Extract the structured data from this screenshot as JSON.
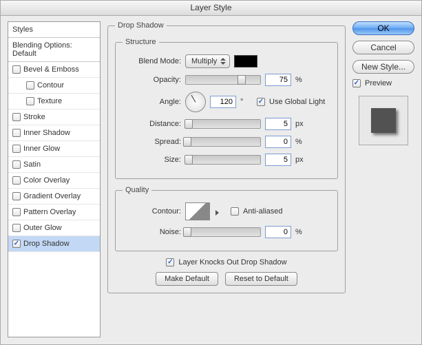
{
  "title": "Layer Style",
  "sidebar": {
    "styles_header": "Styles",
    "blending_header": "Blending Options: Default",
    "items": [
      {
        "label": "Bevel & Emboss",
        "checked": false
      },
      {
        "label": "Contour",
        "checked": false,
        "sub": true
      },
      {
        "label": "Texture",
        "checked": false,
        "sub": true
      },
      {
        "label": "Stroke",
        "checked": false
      },
      {
        "label": "Inner Shadow",
        "checked": false
      },
      {
        "label": "Inner Glow",
        "checked": false
      },
      {
        "label": "Satin",
        "checked": false
      },
      {
        "label": "Color Overlay",
        "checked": false
      },
      {
        "label": "Gradient Overlay",
        "checked": false
      },
      {
        "label": "Pattern Overlay",
        "checked": false
      },
      {
        "label": "Outer Glow",
        "checked": false
      },
      {
        "label": "Drop Shadow",
        "checked": true,
        "selected": true
      }
    ]
  },
  "panel": {
    "heading": "Drop Shadow",
    "structure": {
      "legend": "Structure",
      "blend_mode_label": "Blend Mode:",
      "blend_mode_value": "Multiply",
      "opacity_label": "Opacity:",
      "opacity_value": "75",
      "opacity_unit": "%",
      "angle_label": "Angle:",
      "angle_value": "120",
      "angle_unit": "°",
      "use_global_label": "Use Global Light",
      "use_global_checked": true,
      "distance_label": "Distance:",
      "distance_value": "5",
      "distance_unit": "px",
      "spread_label": "Spread:",
      "spread_value": "0",
      "spread_unit": "%",
      "size_label": "Size:",
      "size_value": "5",
      "size_unit": "px"
    },
    "quality": {
      "legend": "Quality",
      "contour_label": "Contour:",
      "anti_aliased_label": "Anti-aliased",
      "anti_aliased_checked": false,
      "noise_label": "Noise:",
      "noise_value": "0",
      "noise_unit": "%"
    },
    "knockout_label": "Layer Knocks Out Drop Shadow",
    "knockout_checked": true,
    "make_default_label": "Make Default",
    "reset_default_label": "Reset to Default"
  },
  "right": {
    "ok": "OK",
    "cancel": "Cancel",
    "new_style": "New Style...",
    "preview_label": "Preview",
    "preview_checked": true
  }
}
